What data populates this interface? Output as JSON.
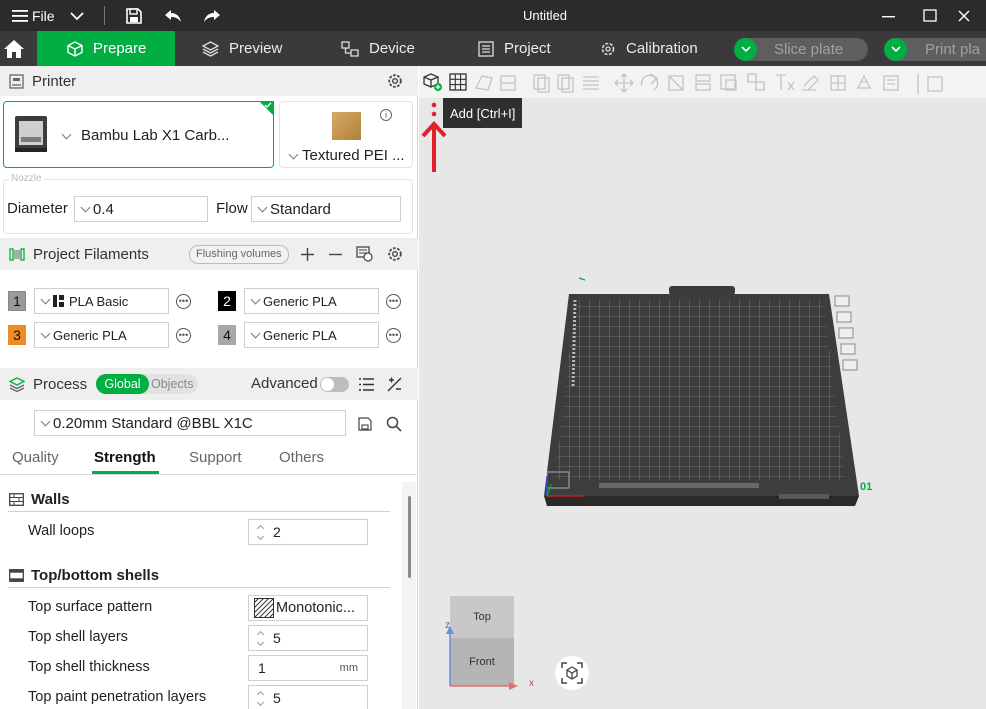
{
  "titlebar": {
    "menu_label": "File",
    "window_title": "Untitled"
  },
  "tabs": [
    {
      "label": "Prepare"
    },
    {
      "label": "Preview"
    },
    {
      "label": "Device"
    },
    {
      "label": "Project"
    },
    {
      "label": "Calibration"
    }
  ],
  "actions": {
    "slice_label": "Slice plate",
    "print_label": "Print pla"
  },
  "printer": {
    "section_title": "Printer",
    "name": "Bambu Lab X1 Carb...",
    "plate": "Textured PEI ...",
    "nozzle_label": "Nozzle",
    "diameter_label": "Diameter",
    "diameter_value": "0.4",
    "flow_label": "Flow",
    "flow_value": "Standard"
  },
  "filaments": {
    "section_title": "Project Filaments",
    "flushing_label": "Flushing volumes",
    "items": [
      {
        "index": "1",
        "name": "PLA Basic",
        "color": "#9a9a9a"
      },
      {
        "index": "2",
        "name": "Generic PLA",
        "color": "#000000"
      },
      {
        "index": "3",
        "name": "Generic PLA",
        "color": "#f08a24"
      },
      {
        "index": "4",
        "name": "Generic PLA",
        "color": "#a8a8a8"
      }
    ]
  },
  "process": {
    "section_title": "Process",
    "global_label": "Global",
    "objects_label": "Objects",
    "advanced_label": "Advanced",
    "preset": "0.20mm Standard @BBL X1C",
    "subtabs": [
      "Quality",
      "Strength",
      "Support",
      "Others"
    ],
    "active_subtab": "Strength"
  },
  "settings": {
    "walls_title": "Walls",
    "wall_loops_label": "Wall loops",
    "wall_loops_value": "2",
    "shells_title": "Top/bottom shells",
    "top_surface_pattern_label": "Top surface pattern",
    "top_surface_pattern_value": "Monotonic...",
    "top_shell_layers_label": "Top shell layers",
    "top_shell_layers_value": "5",
    "top_shell_thickness_label": "Top shell thickness",
    "top_shell_thickness_value": "1",
    "top_shell_thickness_unit": "mm",
    "top_paint_label": "Top paint penetration layers",
    "top_paint_value": "5"
  },
  "viewport": {
    "tooltip": "Add [Ctrl+I]",
    "plate_number": "01",
    "cube_top": "Top",
    "cube_front": "Front",
    "axis_x": "x",
    "axis_z": "z"
  },
  "colors": {
    "accent": "#00ae42",
    "arrow": "#e0202a"
  }
}
